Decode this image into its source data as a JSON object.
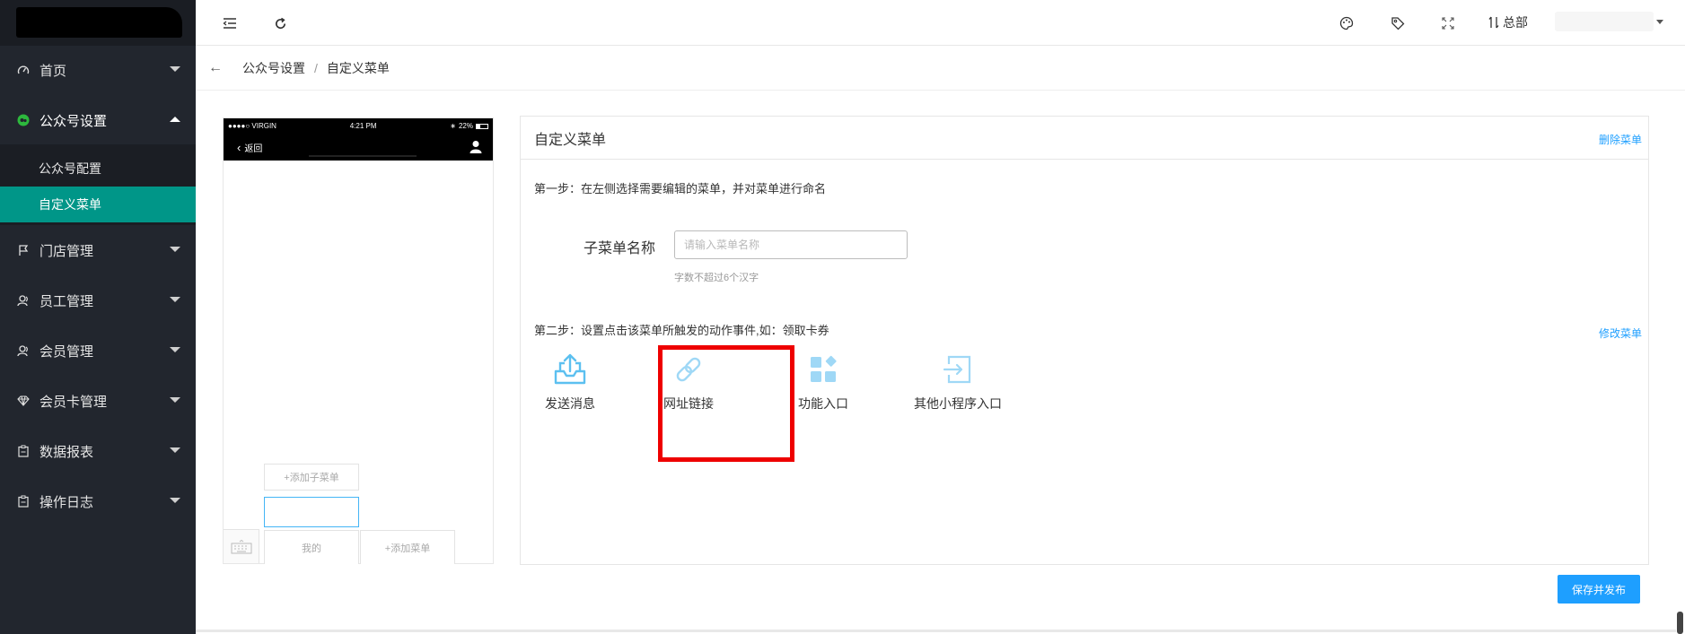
{
  "sidebar": {
    "items": [
      {
        "label": "首页",
        "icon": "dashboard-icon"
      },
      {
        "label": "公众号设置",
        "icon": "wechat-icon"
      },
      {
        "label": "门店管理",
        "icon": "flag-icon"
      },
      {
        "label": "员工管理",
        "icon": "user-icon"
      },
      {
        "label": "会员管理",
        "icon": "members-icon"
      },
      {
        "label": "会员卡管理",
        "icon": "diamond-icon"
      },
      {
        "label": "数据报表",
        "icon": "report-icon"
      },
      {
        "label": "操作日志",
        "icon": "log-icon"
      }
    ],
    "submenu": [
      "公众号配置",
      "自定义菜单"
    ]
  },
  "header": {
    "store_label": "总部"
  },
  "breadcrumb": {
    "items": [
      "公众号设置",
      "自定义菜单"
    ],
    "separator": "/"
  },
  "phone": {
    "carrier": "●●●●○ VIRGIN",
    "time": "4:21 PM",
    "battery": "22%",
    "back_label": "返回",
    "add_submenu": "+添加子菜单",
    "menu_mine": "我的",
    "add_menu": "+添加菜单"
  },
  "panel": {
    "title": "自定义菜单",
    "delete_link": "删除菜单",
    "step1": "第一步：在左侧选择需要编辑的菜单，并对菜单进行命名",
    "field_label": "子菜单名称",
    "field_placeholder": "请输入菜单名称",
    "field_hint": "字数不超过6个汉字",
    "step2": "第二步：设置点击该菜单所触发的动作事件,如：领取卡券",
    "modify_link": "修改菜单",
    "actions": [
      {
        "label": "发送消息",
        "icon": "send-message-icon"
      },
      {
        "label": "网址链接",
        "icon": "link-icon"
      },
      {
        "label": "功能入口",
        "icon": "function-grid-icon"
      },
      {
        "label": "其他小程序入口",
        "icon": "miniprogram-entry-icon"
      }
    ]
  },
  "save_button": "保存并发布",
  "colors": {
    "sidebar_bg": "#22262e",
    "active_teal": "#009688",
    "accent_blue": "#1e9fff",
    "icon_blue": "#5cc0f0",
    "highlight_red": "#ee0000"
  }
}
